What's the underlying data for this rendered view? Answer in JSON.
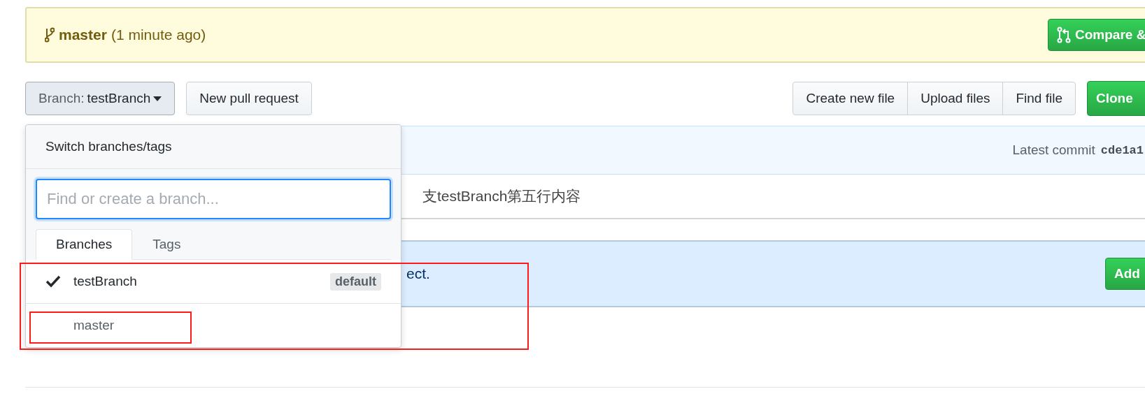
{
  "banner": {
    "branch": "master",
    "time": "(1 minute ago)",
    "button": "Compare &"
  },
  "toolbar": {
    "branch_button": {
      "label": "Branch:",
      "value": "testBranch",
      "expanded": true
    },
    "pull_request_button": "New pull request",
    "file_buttons": [
      "Create new file",
      "Upload files",
      "Find file"
    ],
    "clone_button": "Clone"
  },
  "commit_bar": {
    "label": "Latest commit",
    "sha": "cde1a1"
  },
  "file_row": {
    "message": "支testBranch第五行内容"
  },
  "notice": {
    "text": "ect.",
    "button": "Add"
  },
  "branch_menu": {
    "title": "Switch branches/tags",
    "filter": {
      "placeholder": "Find or create a branch..."
    },
    "tabs": [
      {
        "label": "Branches",
        "selected": true
      },
      {
        "label": "Tags",
        "selected": false
      }
    ],
    "branches": [
      {
        "name": "testBranch",
        "selected": true,
        "badge": "default"
      },
      {
        "name": "master",
        "selected": false
      }
    ]
  }
}
